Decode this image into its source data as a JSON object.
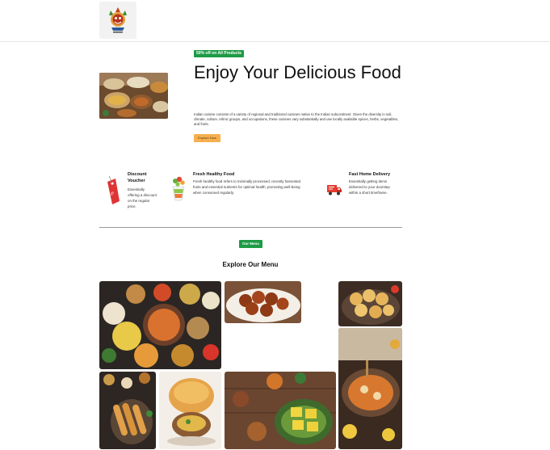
{
  "header": {
    "logo_icon": "temple-mask-logo-icon"
  },
  "hero": {
    "badge": "50% off on All Products",
    "title": "Enjoy Your Delicious Food",
    "description": "Indian cuisine consists of a variety of regional and traditional cuisines native to the Indian subcontinent. Given the diversity in soil, climate, culture, ethnic groups, and occupations, these cuisines vary substantially and use locally available spices, herbs, vegetables, and fruits.",
    "cta_label": "Explore Now"
  },
  "features": [
    {
      "title": "Discount Voucher",
      "text": "Essentially offering a discount on the regular price.",
      "icon": "voucher-tag-icon"
    },
    {
      "title": "Fresh Healthy Food",
      "text": "Fresh healthy food refers to minimally processed, recently harvested fruits and essential nutrients for optimal health, promoting well-being when consumed regularly.",
      "icon": "fresh-food-bowl-icon"
    },
    {
      "title": "Fast Home Delivery",
      "text": "Essentially getting items delivered to your doorstep within a short timeframe.",
      "icon": "delivery-truck-icon"
    }
  ],
  "menu": {
    "badge": "Our Menu",
    "title": "Explore Our Menu"
  },
  "colors": {
    "accent_green": "#1e9b45",
    "cta_orange": "#f6b04e"
  }
}
